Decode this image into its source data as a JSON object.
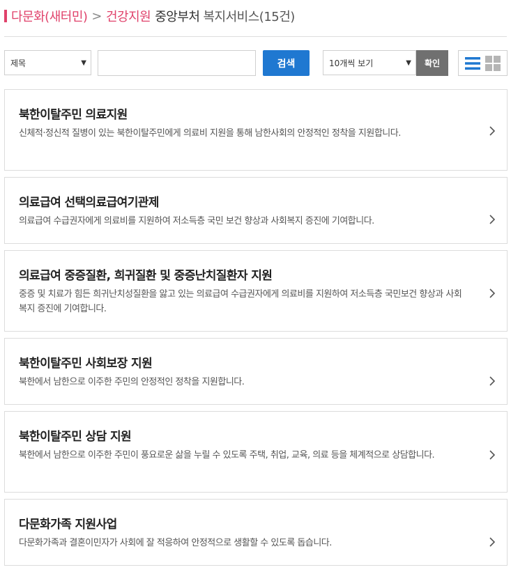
{
  "breadcrumb": {
    "category": "다문화(새터민)",
    "separator": ">",
    "subcategory": "건강지원",
    "ministry": "중앙부처",
    "service_count": "복지서비스(15건)"
  },
  "search": {
    "field_select": "제목",
    "query_value": "",
    "query_placeholder": "",
    "search_label": "검색",
    "page_size": "10개씩 보기",
    "confirm_label": "확인"
  },
  "view_toggle": {
    "active": "list",
    "options": [
      "list-view-icon",
      "grid-view-icon"
    ],
    "active_color": "#1f78d1",
    "inactive_color": "#b5b5b5"
  },
  "colors": {
    "accent_pink": "#e0426b",
    "primary_blue": "#1f78d1",
    "confirm_gray": "#707070"
  },
  "services": [
    {
      "title": "북한이탈주민 의료지원",
      "description": "신체적·정신적 질병이 있는 북한이탈주민에게 의료비 지원을 통해 남한사회의 안정적인 정착을 지원합니다."
    },
    {
      "title": "의료급여 선택의료급여기관제",
      "description": "의료급여 수급권자에게 의료비를 지원하여 저소득층 국민 보건 향상과 사회복지 증진에 기여합니다."
    },
    {
      "title": "의료급여 중증질환, 희귀질환 및 중증난치질환자 지원",
      "description": "중증 및 치료가 힘든 희귀난치성질환을 앓고 있는 의료급여 수급권자에게 의료비를 지원하여 저소득층 국민보건 향상과 사회복지 증진에 기여합니다."
    },
    {
      "title": "북한이탈주민 사회보장 지원",
      "description": "북한에서 남한으로 이주한 주민의 안정적인 정착을 지원합니다."
    },
    {
      "title": "북한이탈주민 상담 지원",
      "description": "북한에서 남한으로 이주한 주민이 풍요로운 삶을 누릴 수 있도록 주택, 취업, 교육, 의료 등을 체계적으로 상담합니다."
    },
    {
      "title": "다문화가족 지원사업",
      "description": "다문화가족과 결혼이민자가 사회에 잘 적응하여 안정적으로 생활할 수 있도록 돕습니다."
    }
  ]
}
